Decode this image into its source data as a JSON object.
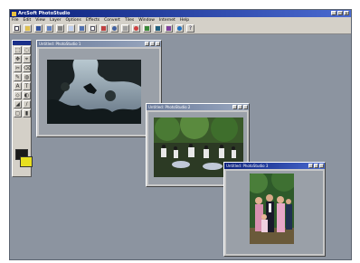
{
  "window": {
    "title": "ArcSoft PhotoStudio",
    "controls": [
      "_",
      "□",
      "×"
    ]
  },
  "menu": [
    "File",
    "Edit",
    "View",
    "Layer",
    "Options",
    "Effects",
    "Convert",
    "Tiles",
    "Window",
    "Internet",
    "Help"
  ],
  "toolbar": {
    "icons": [
      "new-icon",
      "open-icon",
      "save-icon",
      "scan-icon",
      "print-icon",
      "email-icon",
      "cut-icon",
      "copy-icon",
      "paste-icon",
      "undo-icon",
      "redo-icon",
      "zoom-icon",
      "crop-icon",
      "rotate-icon",
      "effects-icon",
      "web-icon",
      "help-icon"
    ],
    "help_label": "?"
  },
  "tools": [
    "⬚",
    "◌",
    "✥",
    "⌖",
    "✂",
    "⌫",
    "✎",
    "◍",
    "A",
    "T",
    "⬦",
    "◐",
    "◢",
    "∕",
    "◻",
    "▮"
  ],
  "colors": {
    "foreground": "#1a1a1a",
    "background": "#e8e020"
  },
  "documents": [
    {
      "title": "Untitled: PhotoStudio 1",
      "active": false
    },
    {
      "title": "Untitled: PhotoStudio 2",
      "active": false
    },
    {
      "title": "Untitled: PhotoStudio 3",
      "active": true
    }
  ]
}
